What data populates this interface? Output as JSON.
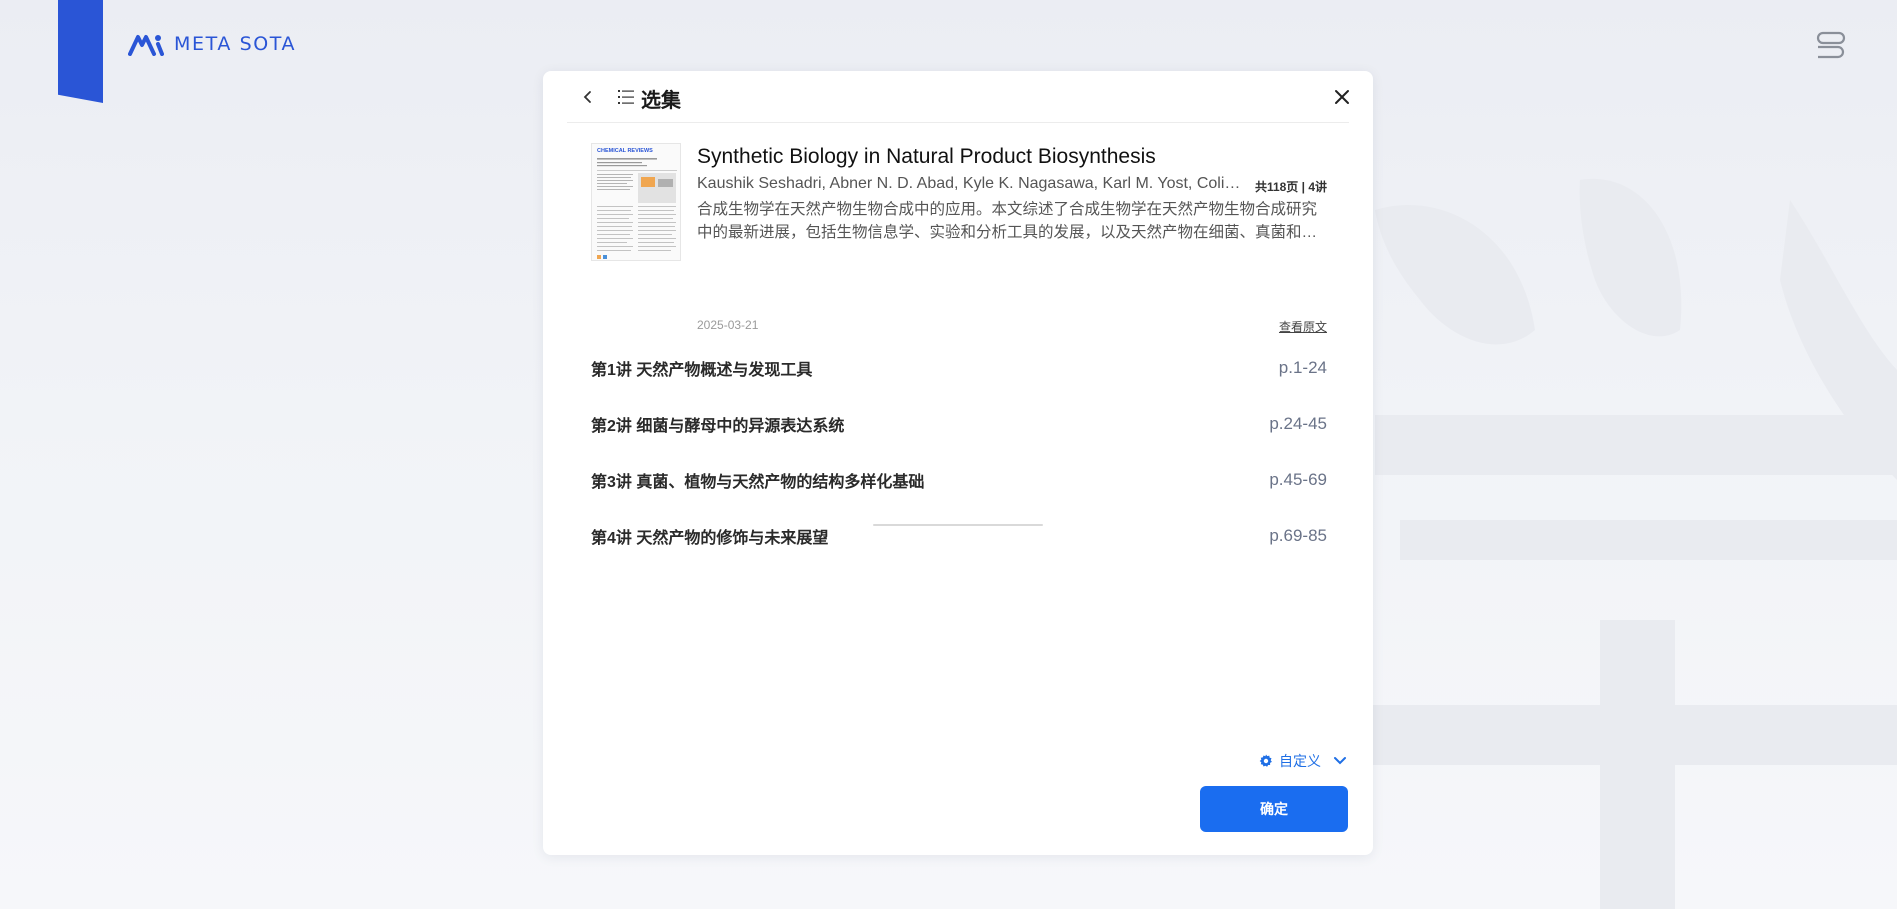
{
  "brand": {
    "name": "META SOTA",
    "color": "#2a55d6",
    "background_char": "学"
  },
  "modal": {
    "title": "选集",
    "back_icon": "chevron-left-icon",
    "list_icon": "list-icon",
    "close_icon": "close-icon"
  },
  "paper": {
    "title": "Synthetic Biology in Natural Product Biosynthesis",
    "authors": "Kaushik Seshadri, Abner N. D. Abad, Kyle K. Nagasawa, Karl M. Yost, Colin W. Johnson",
    "pages_meta": "共118页 | 4讲",
    "summary": "合成生物学在天然产物生物合成中的应用。本文综述了合成生物学在天然产物生物合成研究中的最新进展，包括生物信息学、实验和分析工具的发展，以及天然产物在细菌、真菌和植物中的异源表达。",
    "date": "2025-03-21",
    "view_original": "查看原文",
    "thumbnail": {
      "journal": "CHEMICAL REVIEWS"
    }
  },
  "lectures": [
    {
      "title": "第1讲 天然产物概述与发现工具",
      "pages": "p.1-24"
    },
    {
      "title": "第2讲 细菌与酵母中的异源表达系统",
      "pages": "p.24-45"
    },
    {
      "title": "第3讲 真菌、植物与天然产物的结构多样化基础",
      "pages": "p.45-69"
    },
    {
      "title": "第4讲 天然产物的修饰与未来展望",
      "pages": "p.69-85"
    }
  ],
  "footer": {
    "customize_label": "自定义",
    "customize_icon": "gear-icon",
    "confirm_label": "确定",
    "accent_color": "#1a6df0"
  }
}
